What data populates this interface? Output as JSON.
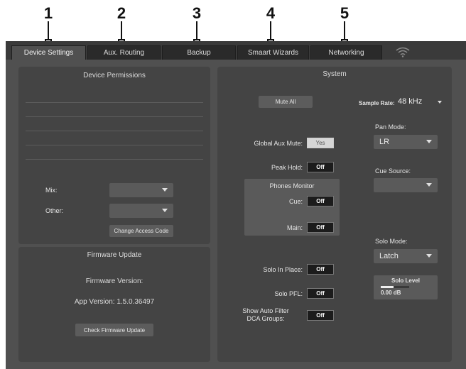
{
  "callouts": [
    "1",
    "2",
    "3",
    "4",
    "5"
  ],
  "tabs": [
    {
      "label": "Device Settings",
      "active": true
    },
    {
      "label": "Aux. Routing",
      "active": false
    },
    {
      "label": "Backup",
      "active": false
    },
    {
      "label": "Smaart Wizards",
      "active": false
    },
    {
      "label": "Networking",
      "active": false
    }
  ],
  "wifi_icon": "wifi-icon",
  "device_permissions": {
    "title": "Device Permissions",
    "mix_label": "Mix:",
    "mix_value": "",
    "other_label": "Other:",
    "other_value": "",
    "change_access_button": "Change Access Code"
  },
  "firmware": {
    "title": "Firmware Update",
    "version_label": "Firmware Version:",
    "app_version": "App Version:  1.5.0.36497",
    "check_button": "Check Firmware Update"
  },
  "system": {
    "title": "System",
    "mute_all_button": "Mute All",
    "sample_rate_label": "Sample Rate:",
    "sample_rate_value": "48 kHz",
    "global_aux_mute_label": "Global Aux Mute:",
    "global_aux_mute_value": "Yes",
    "peak_hold_label": "Peak Hold:",
    "peak_hold_value": "Off",
    "phones_monitor_title": "Phones Monitor",
    "cue_label": "Cue:",
    "cue_value": "Off",
    "main_label": "Main:",
    "main_value": "Off",
    "solo_in_place_label": "Solo In Place:",
    "solo_in_place_value": "Off",
    "solo_pfl_label": "Solo PFL:",
    "solo_pfl_value": "Off",
    "show_auto_filter_label_1": "Show Auto Filter",
    "show_auto_filter_label_2": "DCA Groups:",
    "show_auto_filter_value": "Off",
    "pan_mode_label": "Pan Mode:",
    "pan_mode_value": "LR",
    "cue_source_label": "Cue Source:",
    "cue_source_value": "",
    "solo_mode_label": "Solo Mode:",
    "solo_mode_value": "Latch",
    "solo_level_label": "Solo Level",
    "solo_level_value": "0.00 dB",
    "solo_level_fraction": 0.45
  },
  "colors": {
    "background": "#505050",
    "panel": "#444444",
    "toggle_off": "#1c1c1c",
    "toggle_on": "#d6d6d6"
  }
}
